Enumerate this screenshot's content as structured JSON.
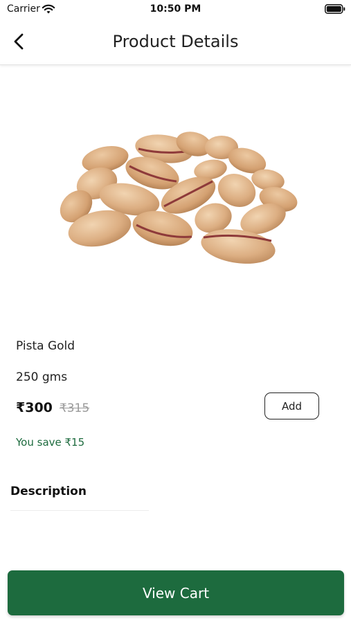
{
  "status_bar": {
    "carrier": "Carrier",
    "time": "10:50 PM",
    "wifi_icon": "wifi-icon",
    "battery_icon": "battery-full-icon"
  },
  "header": {
    "title": "Product Details",
    "back_icon": "chevron-left-icon"
  },
  "product": {
    "image_icon": "pistachio-nuts-image",
    "name": "Pista Gold",
    "weight": "250 gms",
    "price_current": "₹300",
    "price_original": "₹315",
    "savings": "You save ₹15",
    "add_label": "Add"
  },
  "description": {
    "heading": "Description"
  },
  "footer": {
    "view_cart_label": "View Cart"
  },
  "colors": {
    "accent_green": "#1d6b3e",
    "strikethrough_gray": "#9a9a9a"
  }
}
